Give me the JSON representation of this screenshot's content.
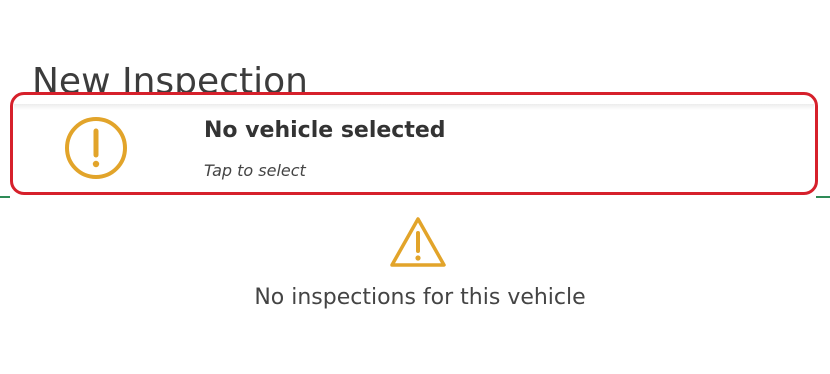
{
  "page": {
    "title": "New Inspection"
  },
  "vehicle_card": {
    "icon": "alert-circle-icon",
    "title": "No vehicle selected",
    "subtitle": "Tap to select"
  },
  "empty_state": {
    "icon": "warning-triangle-icon",
    "message": "No inspections for this vehicle"
  },
  "colors": {
    "warning": "#e2a42a",
    "highlight_border": "#d6202b",
    "accent_line": "#2e8b57"
  }
}
